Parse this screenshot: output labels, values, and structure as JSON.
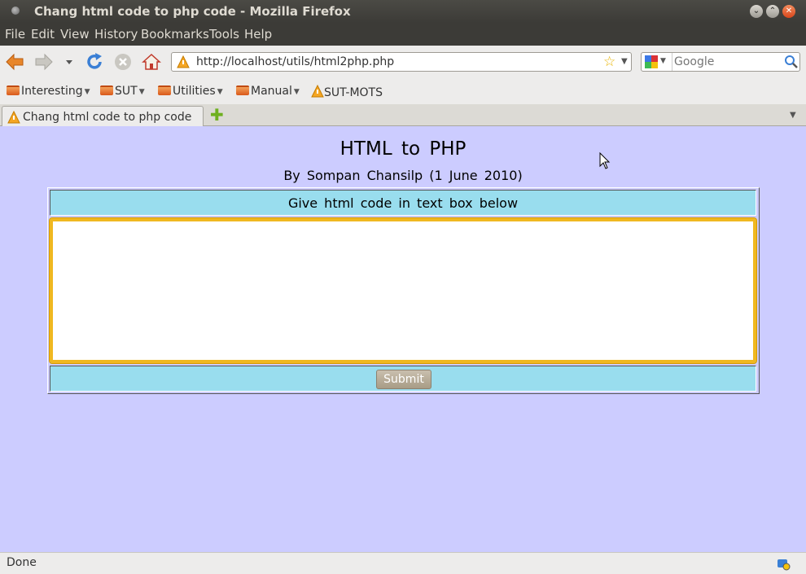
{
  "window": {
    "title": "Chang html code to php code - Mozilla Firefox"
  },
  "menu": [
    "File",
    "Edit",
    "View",
    "History",
    "Bookmarks",
    "Tools",
    "Help"
  ],
  "navigation": {
    "url": "http://localhost/utils/html2php.php",
    "search_placeholder": "Google",
    "icons": [
      "back-arrow-icon",
      "forward-arrow-icon",
      "history-dropdown-icon",
      "reload-icon",
      "stop-icon",
      "home-icon",
      "site-identity-icon",
      "bookmark-star-icon",
      "search-engine-icon",
      "magnifier-icon"
    ]
  },
  "bookmarks": [
    {
      "label": "Interesting",
      "type": "folder"
    },
    {
      "label": "SUT",
      "type": "folder"
    },
    {
      "label": "Utilities",
      "type": "folder"
    },
    {
      "label": "Manual",
      "type": "folder"
    },
    {
      "label": "SUT-MOTS",
      "type": "link"
    }
  ],
  "tabs": [
    {
      "label": "Chang html code to php code",
      "active": true
    }
  ],
  "page": {
    "title": "HTML to PHP",
    "byline": "By Sompan Chansilp (1 June 2010)",
    "instruction": "Give html code in text box below",
    "textarea_value": "",
    "submit_label": "Submit",
    "background": "#ccccff",
    "panel_color": "#99ddee",
    "focus_ring_color": "#f0b820"
  },
  "status": {
    "text": "Done"
  }
}
